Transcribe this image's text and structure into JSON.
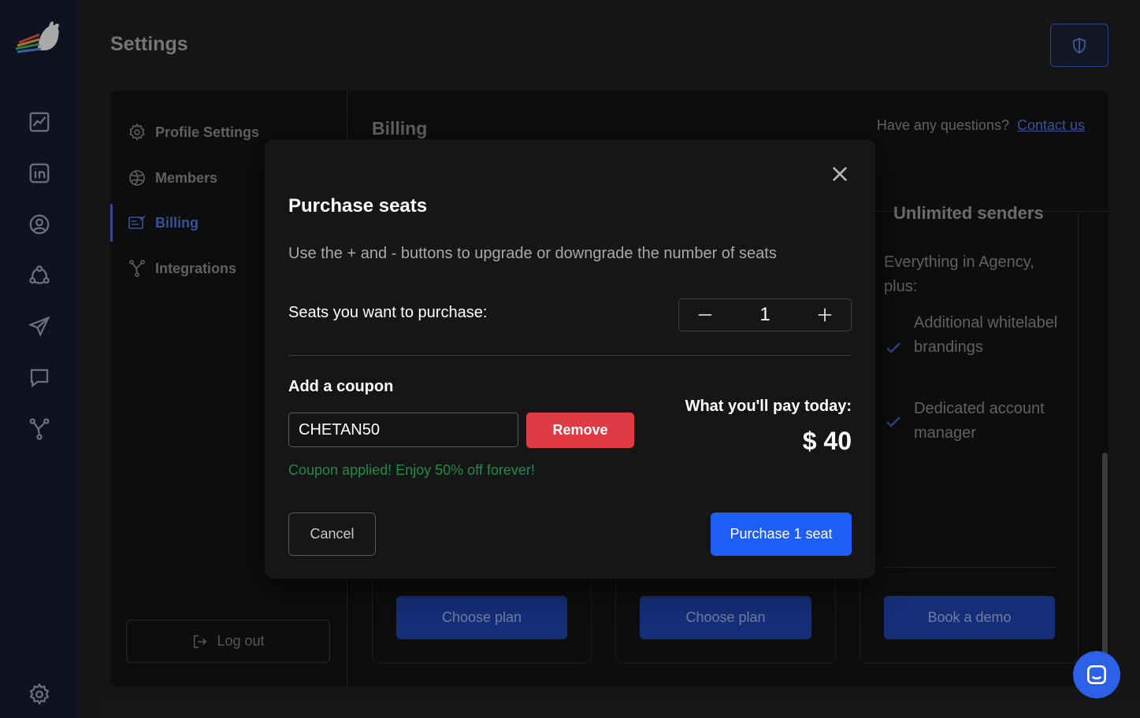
{
  "page": {
    "title": "Settings"
  },
  "settings_nav": {
    "items": [
      {
        "label": "Profile Settings",
        "icon": "gear-icon"
      },
      {
        "label": "Members",
        "icon": "globe-icon"
      },
      {
        "label": "Billing",
        "icon": "billing-icon",
        "active": true
      },
      {
        "label": "Integrations",
        "icon": "share-icon"
      }
    ],
    "logout_label": "Log out"
  },
  "billing": {
    "title": "Billing",
    "questions_text": "Have any questions?",
    "contact_link": "Contact us",
    "plans": [
      {
        "button": "Choose plan"
      },
      {
        "button": "Choose plan"
      },
      {
        "heading": "Unlimited senders",
        "intro": "Everything in Agency, plus:",
        "features": [
          "Additional whitelabel brandings",
          "Dedicated account manager"
        ],
        "button": "Book a demo"
      }
    ]
  },
  "modal": {
    "title": "Purchase seats",
    "description": "Use the + and - buttons to upgrade or downgrade the number of seats",
    "seats_label": "Seats you want to purchase:",
    "seats_value": "1",
    "coupon_label": "Add a coupon",
    "coupon_value": "CHETAN50",
    "remove_label": "Remove",
    "coupon_message": "Coupon applied! Enjoy 50% off forever!",
    "pay_label": "What you'll pay today:",
    "pay_amount": "$ 40",
    "cancel_label": "Cancel",
    "purchase_label": "Purchase 1 seat"
  },
  "colors": {
    "accent": "#1e5ef5",
    "danger": "#e03a45",
    "success": "#1f8a4c",
    "rail": "#171a2e"
  }
}
